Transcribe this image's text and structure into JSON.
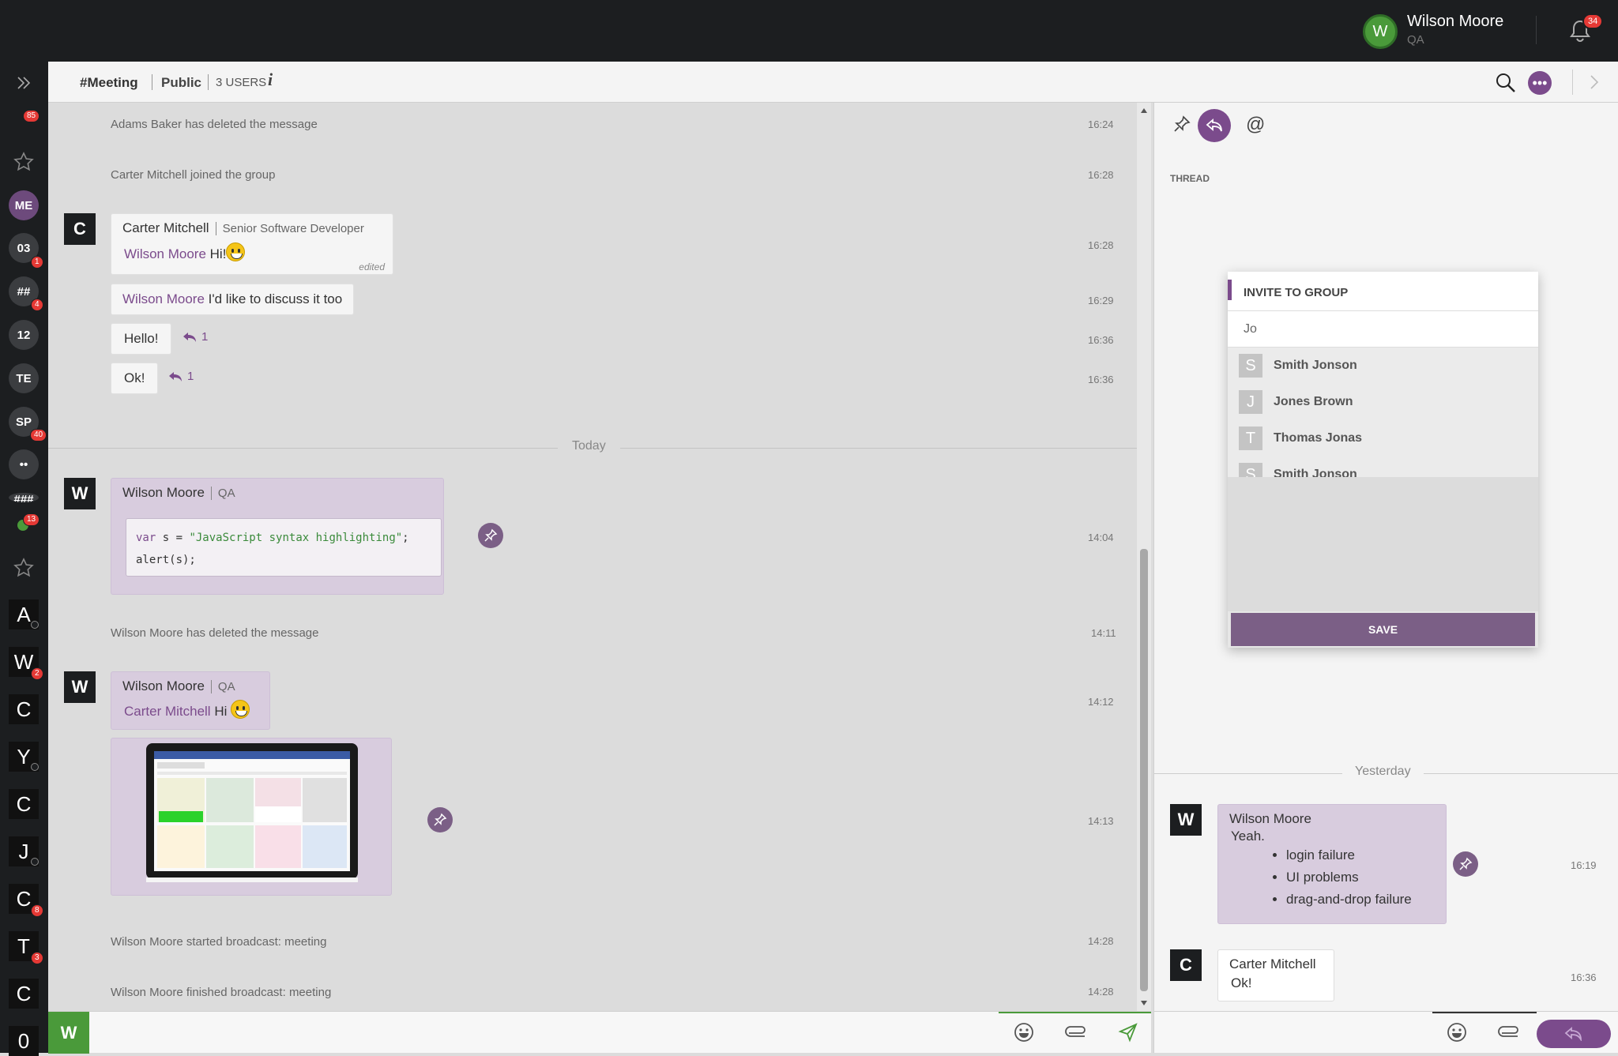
{
  "user": {
    "initial": "W",
    "name": "Wilson Moore",
    "role": "QA",
    "notifications": "34"
  },
  "channel": {
    "name": "#Meeting",
    "type": "Public",
    "users": "3 USERS",
    "info": "i"
  },
  "sidebar": {
    "badge_top": "85",
    "badge_bottom": "13",
    "items": [
      {
        "label": "ME"
      },
      {
        "label": "03",
        "badge": "1"
      },
      {
        "label": "##",
        "badge": "4"
      },
      {
        "label": "12"
      },
      {
        "label": "TE"
      },
      {
        "label": "SP",
        "badge": "40"
      },
      {
        "label": "••"
      },
      {
        "label": "###"
      }
    ],
    "contacts": [
      {
        "letter": "A"
      },
      {
        "letter": "W",
        "badge": "2"
      },
      {
        "letter": "C"
      },
      {
        "letter": "Y"
      },
      {
        "letter": "C"
      },
      {
        "letter": "J"
      },
      {
        "letter": "C",
        "badge": "8"
      },
      {
        "letter": "T",
        "badge": "3"
      },
      {
        "letter": "C"
      },
      {
        "letter": "0"
      }
    ]
  },
  "messages": {
    "sys1": {
      "text": "Adams Baker has deleted the message",
      "time": "16:24"
    },
    "sys2": {
      "text": "Carter Mitchell joined the group",
      "time": "16:28"
    },
    "m1": {
      "initial": "C",
      "author": "Carter Mitchell",
      "role": "Senior Software Developer",
      "mention": "Wilson Moore",
      "text": "Hi!",
      "edited": "edited",
      "time": "16:28"
    },
    "m2": {
      "mention": "Wilson Moore",
      "text": "I'd like to discuss it too",
      "time": "16:29"
    },
    "m3": {
      "text": "Hello!",
      "replies": "1",
      "time": "16:36"
    },
    "m4": {
      "text": "Ok!",
      "replies": "1",
      "time": "16:36"
    },
    "today": "Today",
    "m5": {
      "initial": "W",
      "author": "Wilson Moore",
      "role": "QA",
      "code_kw": "var",
      "code_mid": " s = ",
      "code_str": "\"JavaScript syntax highlighting\"",
      "code_end": ";",
      "code_line2": "alert(s);",
      "time": "14:04"
    },
    "sys3": {
      "text": "Wilson Moore has deleted the message",
      "time": "14:11"
    },
    "m6": {
      "initial": "W",
      "author": "Wilson Moore",
      "role": "QA",
      "mention": "Carter Mitchell",
      "text": "Hi",
      "time": "14:12",
      "image_time": "14:13"
    },
    "sys4": {
      "text": "Wilson Moore started broadcast: meeting",
      "time": "14:28"
    },
    "sys5": {
      "text": "Wilson Moore finished broadcast: meeting",
      "time": "14:28"
    }
  },
  "thread": {
    "title": "THREAD",
    "at": "@",
    "yesterday": "Yesterday",
    "t1": {
      "initial": "W",
      "author": "Wilson Moore",
      "text": "Yeah.",
      "items": [
        "login failure",
        "UI problems",
        "drag-and-drop failure"
      ],
      "time": "16:19"
    },
    "t2": {
      "initial": "C",
      "author": "Carter Mitchell",
      "text": "Ok!",
      "time": "16:36"
    }
  },
  "invite": {
    "title": "INVITE TO GROUP",
    "query": "Jo",
    "options": [
      {
        "letter": "S",
        "name": "Smith Jonson"
      },
      {
        "letter": "J",
        "name": "Jones Brown"
      },
      {
        "letter": "T",
        "name": "Thomas Jonas"
      },
      {
        "letter": "S",
        "name": "Smith Jonson"
      }
    ],
    "save": "SAVE"
  },
  "input": {
    "initial": "W"
  },
  "colors": {
    "accent": "#7b4b8c",
    "online": "#4a9a3a",
    "badge": "#e53935",
    "topbar": "#1c1e20"
  }
}
